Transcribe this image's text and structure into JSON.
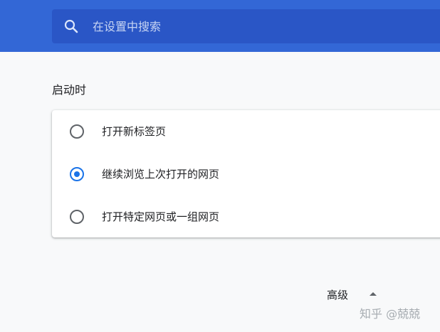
{
  "header": {
    "search_placeholder": "在设置中搜索",
    "search_value": "",
    "search_icon": "search-icon",
    "bar_color": "#3367d6",
    "search_box_color": "#2a56c6"
  },
  "startup": {
    "title": "启动时",
    "options": [
      {
        "label": "打开新标签页",
        "checked": false
      },
      {
        "label": "继续浏览上次打开的网页",
        "checked": true
      },
      {
        "label": "打开特定网页或一组网页",
        "checked": false
      }
    ],
    "accent_color": "#1a73e8"
  },
  "advanced": {
    "label": "高级",
    "icon": "arrow-up-icon"
  },
  "watermark": {
    "text": "知乎 @兢兢"
  }
}
